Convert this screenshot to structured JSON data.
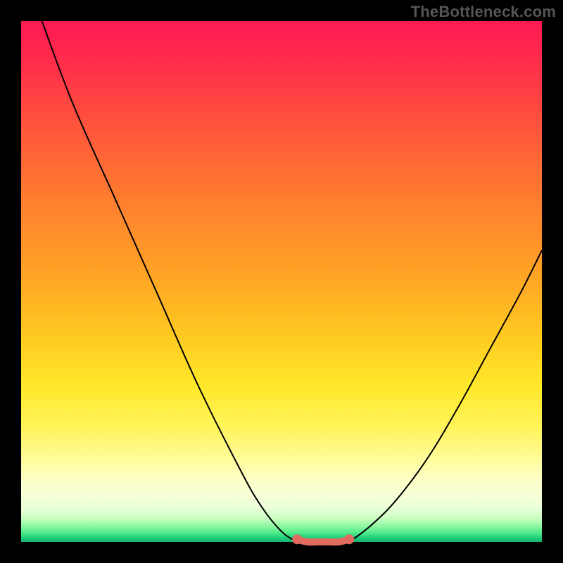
{
  "watermark": "TheBottleneck.com",
  "chart_data": {
    "type": "line",
    "title": "",
    "xlabel": "",
    "ylabel": "",
    "xlim": [
      0,
      100
    ],
    "ylim": [
      0,
      100
    ],
    "grid": false,
    "series": [
      {
        "name": "left-curve",
        "x": [
          4,
          10,
          18,
          26,
          34,
          42,
          46,
          50,
          53
        ],
        "values": [
          100,
          84,
          66,
          48,
          30,
          14,
          7,
          2,
          0
        ]
      },
      {
        "name": "right-curve",
        "x": [
          63,
          67,
          72,
          78,
          84,
          90,
          96,
          100
        ],
        "values": [
          0,
          3,
          8,
          16,
          26,
          37,
          48,
          56
        ]
      },
      {
        "name": "trough",
        "x": [
          53,
          55,
          57,
          59,
          61,
          63
        ],
        "values": [
          0.5,
          0,
          0,
          0,
          0,
          0.5
        ]
      }
    ],
    "colors": {
      "curve": "#000000",
      "trough": "#e26b5f",
      "gradient_top": "#ff1954",
      "gradient_mid": "#ffe82a",
      "gradient_bottom_green": "#17b46f"
    }
  }
}
